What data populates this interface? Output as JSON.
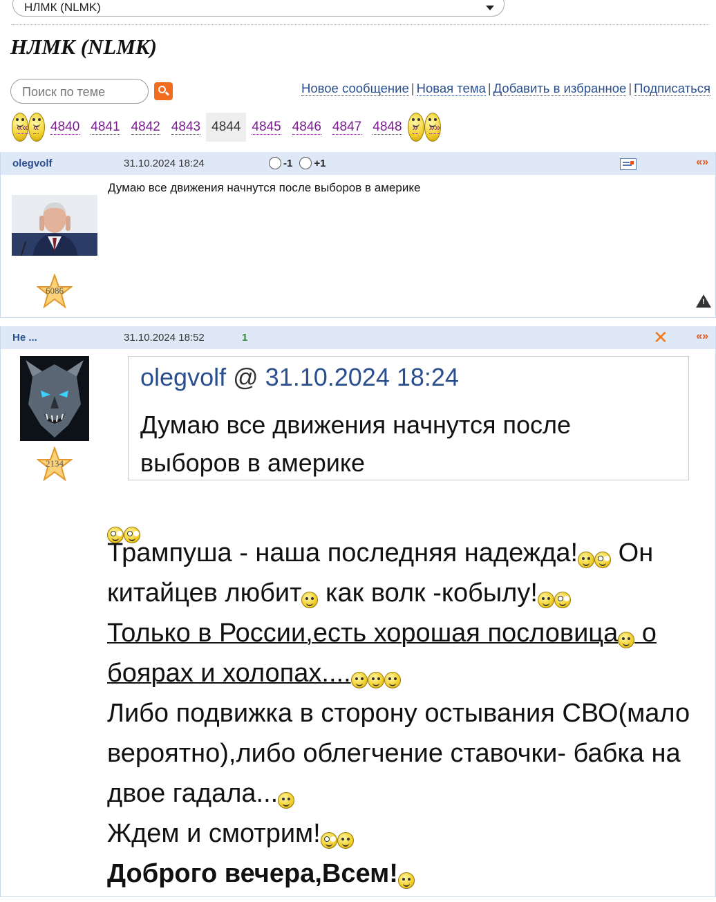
{
  "topic_select": {
    "value": "НЛМК (NLMK)"
  },
  "page_title": "НЛМК (NLMK)",
  "search": {
    "placeholder": "Поиск по теме"
  },
  "actions": {
    "new_message": "Новое сообщение",
    "new_topic": "Новая тема",
    "add_favorite": "Добавить в избранное",
    "subscribe": "Подписаться",
    "separator": "|"
  },
  "pager": {
    "first": "««",
    "prev": "«",
    "pages": [
      "4840",
      "4841",
      "4842",
      "4843",
      "4844",
      "4845",
      "4846",
      "4847",
      "4848"
    ],
    "current": "4844",
    "next": "»",
    "last": "»»"
  },
  "posts": [
    {
      "author": "olegvolf",
      "date": "31.10.2024 18:24",
      "vote_minus": "-1",
      "vote_plus": "+1",
      "rating": "6086",
      "arrows": "«»",
      "text": "Думаю все движения начнутся после выборов в америке"
    },
    {
      "author": "Не ...",
      "date": "31.10.2024 18:52",
      "reply_count": "1",
      "rating": "2134",
      "arrows": "«»",
      "quote": {
        "author": "olegvolf",
        "at": "@",
        "date": "31.10.2024 18:24",
        "text": "Думаю все движения начнутся после выборов в америке"
      },
      "lines": {
        "l1a": "Трампуша - наша последняя надежда!",
        "l1b": " Он китайцев любит",
        "l1c": " как волк -кобылу!",
        "l2a": "Только в России,есть хорошая пословица",
        "l2b": " о боярах и холопах....",
        "l3": "Либо подвижка в сторону остывания СВО(мало вероятно),либо облегчение ставочки- бабка на двое гадала...",
        "l4": "Ждем и смотрим!",
        "l5": "Доброго вечера,Всем!"
      }
    }
  ],
  "colors": {
    "link": "#2a4f8e",
    "page_link": "#7a1d8f",
    "header_bg": "#dfe8f6",
    "accent": "#f26c1e"
  }
}
